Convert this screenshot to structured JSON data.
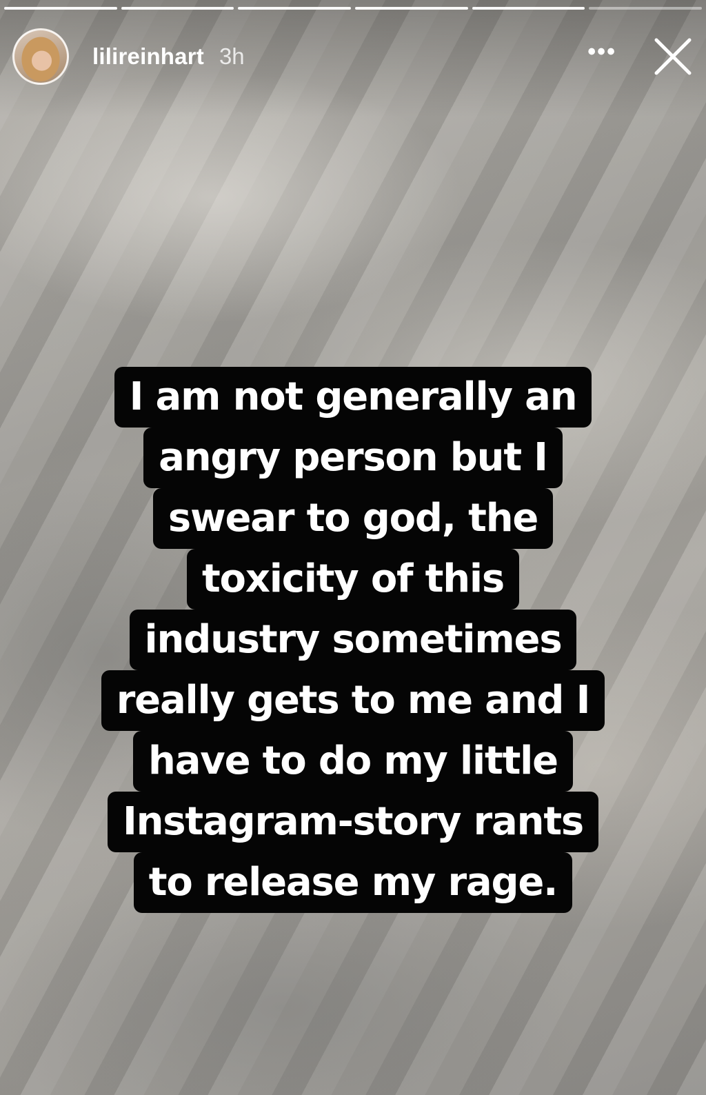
{
  "story": {
    "progress": {
      "segments_total": 6,
      "segments_done": 5
    },
    "header": {
      "username": "lilireinhart",
      "timestamp": "3h",
      "more_label": "•••",
      "close_icon": "close-icon"
    },
    "caption": {
      "lines": [
        "I am not generally an",
        "angry person but I",
        "swear to god, the",
        "toxicity of this",
        "industry sometimes",
        "really gets to me and I",
        "have to do my little",
        "Instagram-story rants",
        "to release my rage."
      ]
    }
  }
}
